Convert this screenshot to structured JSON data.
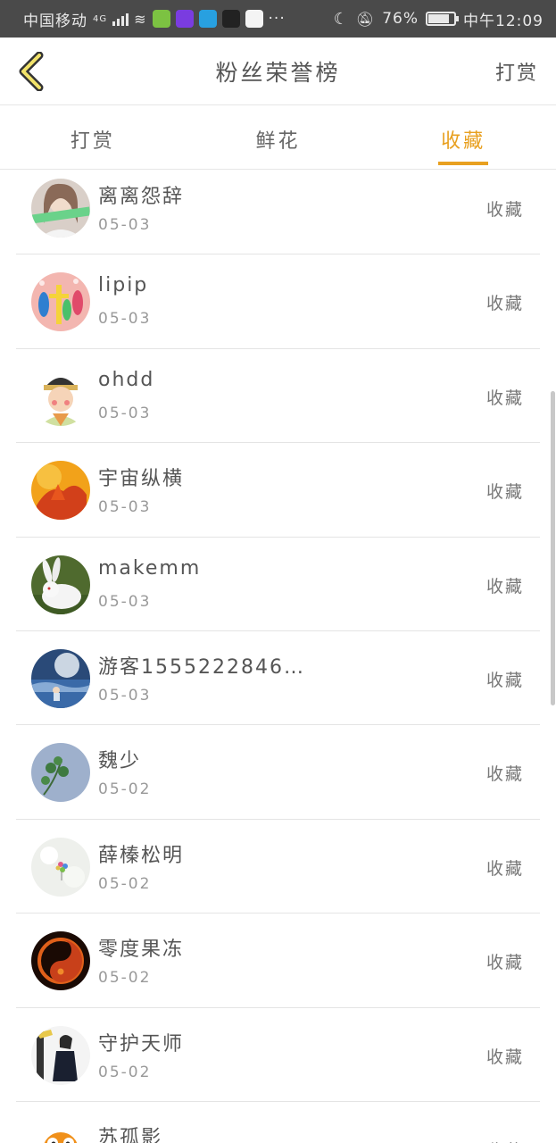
{
  "status_bar": {
    "carrier": "中国移动",
    "network": "4G",
    "battery": "76%",
    "time": "中午12:09",
    "more": "···"
  },
  "header": {
    "back_icon": "chevron-left-icon",
    "title": "粉丝荣誉榜",
    "action": "打赏"
  },
  "tabs": [
    {
      "label": "打赏",
      "active": false
    },
    {
      "label": "鲜花",
      "active": false
    },
    {
      "label": "收藏",
      "active": true
    }
  ],
  "colors": {
    "accent": "#e8a020",
    "statusbar": "#4a4a4a"
  },
  "rows": [
    {
      "name": "离离怨辞",
      "date": "05-03",
      "action": "收藏"
    },
    {
      "name": "lipip",
      "date": "05-03",
      "action": "收藏"
    },
    {
      "name": "ohdd",
      "date": "05-03",
      "action": "收藏"
    },
    {
      "name": "宇宙纵横",
      "date": "05-03",
      "action": "收藏"
    },
    {
      "name": "makemm",
      "date": "05-03",
      "action": "收藏"
    },
    {
      "name": "游客1555222846…",
      "date": "05-03",
      "action": "收藏"
    },
    {
      "name": "魏少",
      "date": "05-02",
      "action": "收藏"
    },
    {
      "name": "薛榛松明",
      "date": "05-02",
      "action": "收藏"
    },
    {
      "name": "零度果冻",
      "date": "05-02",
      "action": "收藏"
    },
    {
      "name": "守护天师",
      "date": "05-02",
      "action": "收藏"
    },
    {
      "name": "苏孤影",
      "date": "",
      "action": "收藏"
    }
  ]
}
